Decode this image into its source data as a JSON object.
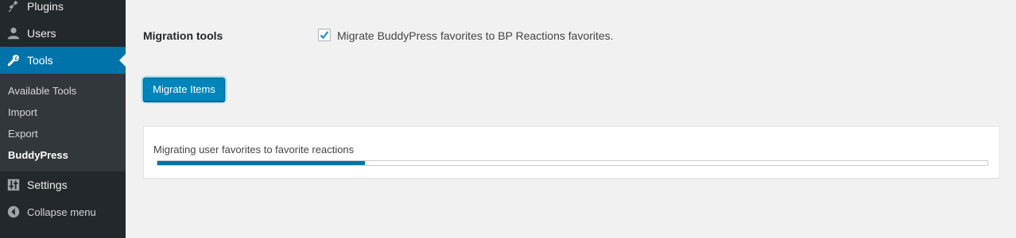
{
  "sidebar": {
    "items": [
      {
        "label": "Plugins",
        "icon": "plugin-icon"
      },
      {
        "label": "Users",
        "icon": "users-icon"
      },
      {
        "label": "Tools",
        "icon": "wrench-icon"
      },
      {
        "label": "Settings",
        "icon": "settings-icon"
      },
      {
        "label": "Collapse menu",
        "icon": "collapse-icon"
      }
    ],
    "submenu": [
      "Available Tools",
      "Import",
      "Export",
      "BuddyPress"
    ],
    "active_item": "Tools",
    "active_submenu": "BuddyPress"
  },
  "main": {
    "section_label": "Migration tools",
    "checkbox_label": "Migrate BuddyPress favorites to BP Reactions favorites.",
    "checkbox_checked": true,
    "button_label": "Migrate Items",
    "progress": {
      "text": "Migrating user favorites to favorite reactions",
      "fraction": 0.25
    }
  },
  "colors": {
    "sidebar_bg": "#23282d",
    "submenu_bg": "#32373c",
    "accent": "#0073aa",
    "button": "#0085ba",
    "page_bg": "#f1f1f1"
  }
}
